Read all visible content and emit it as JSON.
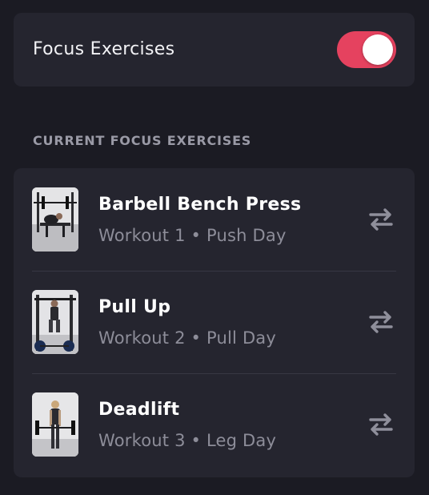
{
  "focus_toggle": {
    "label": "Focus Exercises",
    "enabled": true,
    "accent_color": "#e5425f"
  },
  "section": {
    "title": "CURRENT FOCUS EXERCISES"
  },
  "exercises": [
    {
      "name": "Barbell Bench Press",
      "subtitle": "Workout 1 • Push Day",
      "thumbnail": "bench-press-photo",
      "action_icon": "swap-icon"
    },
    {
      "name": "Pull Up",
      "subtitle": "Workout 2 • Pull Day",
      "thumbnail": "pull-up-photo",
      "action_icon": "swap-icon"
    },
    {
      "name": "Deadlift",
      "subtitle": "Workout 3 • Leg Day",
      "thumbnail": "deadlift-photo",
      "action_icon": "swap-icon"
    }
  ]
}
